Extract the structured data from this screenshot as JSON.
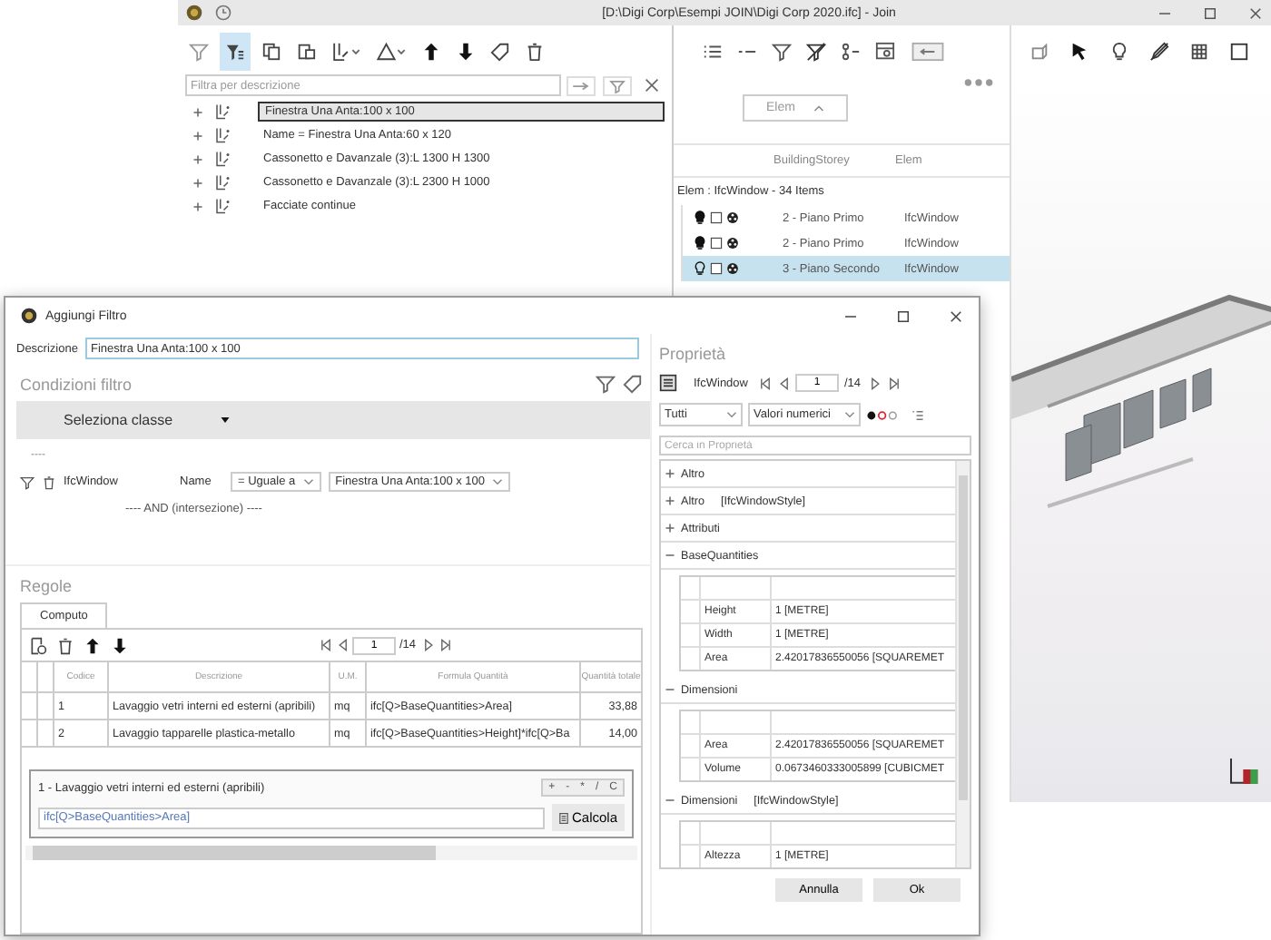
{
  "main_window": {
    "title": "[D:\\Digi Corp\\Esempi JOIN\\Digi Corp 2020.ifc] - Join"
  },
  "filters": {
    "placeholder": "Filtra per descrizione",
    "items": [
      {
        "label": "Finestra Una Anta:100 x 100",
        "selected": true
      },
      {
        "label": "Name = Finestra Una Anta:60 x 120",
        "selected": false
      },
      {
        "label": "Cassonetto e Davanzale (3):L 1300 H 1300",
        "selected": false
      },
      {
        "label": "Cassonetto e Davanzale (3):L 2300 H 1000",
        "selected": false
      },
      {
        "label": "Facciate continue",
        "selected": false
      }
    ]
  },
  "elements": {
    "group_by": "Elem",
    "columns": [
      "BuildingStorey",
      "Elem"
    ],
    "group": "Elem : IfcWindow - 34 Items",
    "rows": [
      {
        "visible": true,
        "storey": "2 - Piano Primo",
        "elem": "IfcWindow",
        "selected": false
      },
      {
        "visible": true,
        "storey": "2 - Piano Primo",
        "elem": "IfcWindow",
        "selected": false
      },
      {
        "visible": false,
        "storey": "3 - Piano Secondo",
        "elem": "IfcWindow",
        "selected": true
      }
    ]
  },
  "dialog": {
    "title": "Aggiungi Filtro",
    "description_label": "Descrizione",
    "description": "Finestra Una Anta:100 x 100",
    "conditions_heading": "Condizioni filtro",
    "class_select": "Seleziona classe",
    "separator": "----",
    "condition": {
      "class": "IfcWindow",
      "property": "Name",
      "operator": "= Uguale a",
      "value": "Finestra Una Anta:100 x 100"
    },
    "conjunction": "---- AND (intersezione) ----",
    "rules_heading": "Regole",
    "tabs": [
      {
        "label": "Computo",
        "selected": true
      }
    ],
    "pager": {
      "page": "1",
      "total": "/14"
    },
    "table": {
      "columns": [
        "Codice",
        "Descrizione",
        "U.M.",
        "Formula Quantità",
        "Quantità totale"
      ],
      "rows": [
        [
          "1",
          "Lavaggio vetri interni ed esterni (apribili)",
          "mq",
          "ifc[Q>BaseQuantities>Area]",
          "33,88"
        ],
        [
          "2",
          "Lavaggio tapparelle plastica-metallo",
          "mq",
          "ifc[Q>BaseQuantities>Height]*ifc[Q>Ba",
          "14,00"
        ]
      ]
    },
    "formula": {
      "title": "1 - Lavaggio vetri interni ed esterni (apribili)",
      "keys": [
        "+",
        "-",
        "*",
        "/",
        "C"
      ],
      "value": "ifc[Q>BaseQuantities>Area]",
      "button": "Calcola"
    },
    "properties": {
      "heading": "Proprietà",
      "class": "IfcWindow",
      "page": "1",
      "total": "/14",
      "scope": "Tutti",
      "filter": "Valori numerici",
      "search_placeholder": "Cerca in Proprietà",
      "groups": [
        {
          "name": "Altro",
          "expanded": false
        },
        {
          "name": "Altro",
          "type": "[IfcWindowStyle]",
          "expanded": false
        },
        {
          "name": "Attributi",
          "expanded": false
        },
        {
          "name": "BaseQuantities",
          "expanded": true,
          "rows": [
            [
              "Height",
              "1 [METRE]"
            ],
            [
              "Width",
              "1 [METRE]"
            ],
            [
              "Area",
              "2.42017836550056 [SQUAREMET"
            ]
          ]
        },
        {
          "name": "Dimensioni",
          "expanded": true,
          "rows": [
            [
              "Area",
              "2.42017836550056 [SQUAREMET"
            ],
            [
              "Volume",
              "0.0673460333005899 [CUBICMET"
            ]
          ]
        },
        {
          "name": "Dimensioni",
          "type": "[IfcWindowStyle]",
          "expanded": true,
          "rows": [
            [
              "Altezza",
              "1 [METRE]"
            ]
          ]
        }
      ]
    },
    "buttons": [
      "Annulla",
      "Ok"
    ]
  }
}
